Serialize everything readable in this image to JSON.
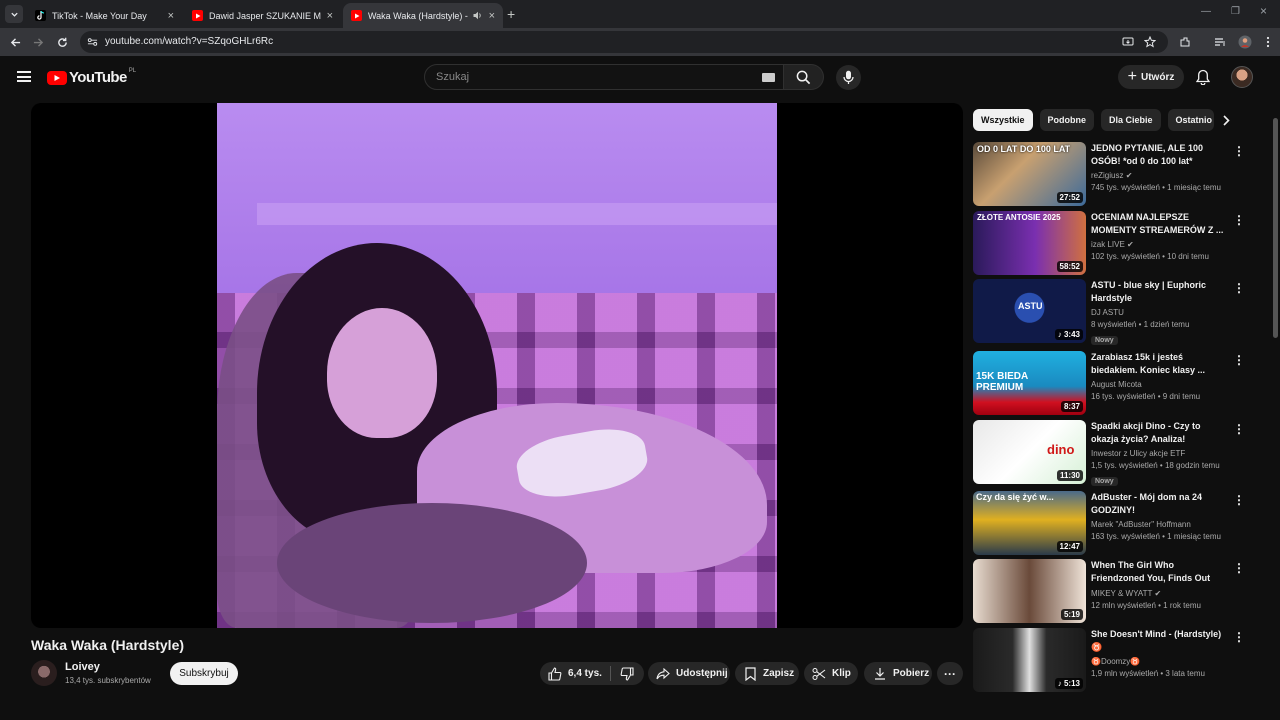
{
  "browser": {
    "tabs": [
      {
        "title": "TikTok - Make Your Day",
        "color": "#000000"
      },
      {
        "title": "Dawid Jasper SZUKANIE MIŁOŚ",
        "color": "#ff0000"
      },
      {
        "title": "Waka Waka (Hardstyle) - Yo",
        "color": "#ff0000"
      }
    ],
    "url": "youtube.com/watch?v=SZqoGHLr6Rc"
  },
  "masthead": {
    "logo_text": "YouTube",
    "region": "PL",
    "search_placeholder": "Szukaj",
    "create_label": "Utwórz"
  },
  "video": {
    "title": "Waka Waka (Hardstyle)",
    "channel": "Loivey",
    "subscribers": "13,4 tys. subskrybentów",
    "subscribe_label": "Subskrybuj",
    "likes": "6,4 tys.",
    "share_label": "Udostępnij",
    "save_label": "Zapisz",
    "clip_label": "Klip",
    "download_label": "Pobierz"
  },
  "sidebar": {
    "chips": [
      "Wszystkie",
      "Podobne",
      "Dla Ciebie",
      "Ostatnio"
    ],
    "recommendations": [
      {
        "title": "JEDNO PYTANIE, ALE 100 OSÓB! *od 0 do 100 lat*",
        "channel": "reZigiusz",
        "verified": true,
        "views": "745 tys. wyświetleń • 1 miesiąc temu",
        "duration": "27:52",
        "thumb_text": "OD 0 LAT DO 100 LAT"
      },
      {
        "title": "OCENIAM NAJLEPSZE MOMENTY STREAMERÓW Z ...",
        "channel": "izak LIVE",
        "verified": true,
        "views": "102 tys. wyświetleń • 10 dni temu",
        "duration": "58:52",
        "thumb_text": "ZŁOTE ANTOSIE 2025"
      },
      {
        "title": "ASTU - blue sky | Euphoric Hardstyle",
        "channel": "DJ ASTU",
        "verified": false,
        "views": "8 wyświetleń • 1 dzień temu",
        "duration": "3:43",
        "badge": "Nowy",
        "thumb_text": "ASTU"
      },
      {
        "title": "Zarabiasz 15k i jesteś biedakiem. Koniec klasy ...",
        "channel": "August Micota",
        "verified": false,
        "views": "16 tys. wyświetleń • 9 dni temu",
        "duration": "8:37",
        "thumb_text": "15K BIEDA PREMIUM"
      },
      {
        "title": "Spadki akcji Dino - Czy to okazja życia? Analiza!",
        "channel": "Inwestor z Ulicy akcje ETF",
        "verified": false,
        "views": "1,5 tys. wyświetleń • 18 godzin temu",
        "duration": "11:30",
        "badge": "Nowy",
        "thumb_text": "dino"
      },
      {
        "title": "AdBuster - Mój dom na 24 GODZINY!",
        "channel": "Marek \"AdBuster\" Hoffmann",
        "verified": false,
        "views": "163 tys. wyświetleń • 1 miesiąc temu",
        "duration": "12:47",
        "thumb_text": "Czy da się żyć w..."
      },
      {
        "title": "When The Girl Who Friendzoned You, Finds Out You Moved On",
        "channel": "MIKEY & WYATT",
        "verified": true,
        "views": "12 mln wyświetleń • 1 rok temu",
        "duration": "5:19",
        "thumb_text": ""
      },
      {
        "title": "She Doesn't Mind - (Hardstyle) ♉",
        "channel": "♉Doomzy♉",
        "verified": false,
        "views": "1,9 mln wyświetleń • 3 lata temu",
        "duration": "5:13",
        "thumb_text": ""
      }
    ]
  },
  "colors": {
    "accent": "#ff0000",
    "bg": "#0f0f0f",
    "pill": "#272727"
  }
}
